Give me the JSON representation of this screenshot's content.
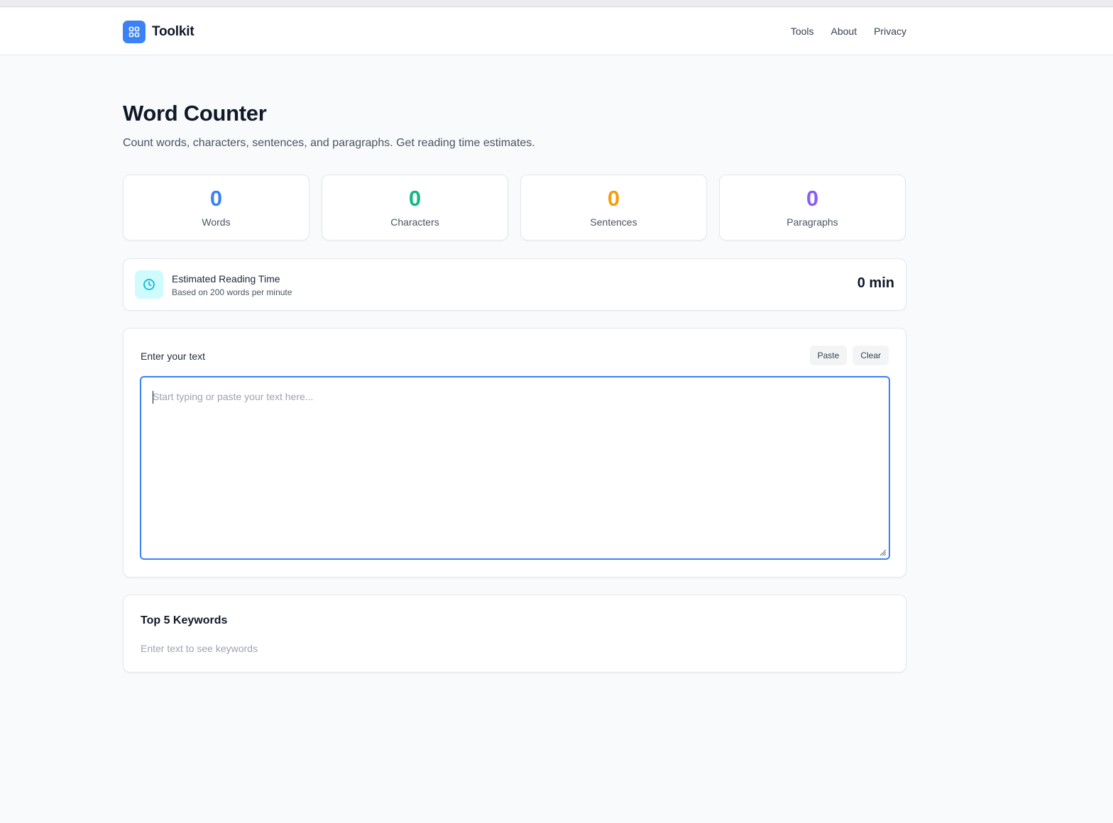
{
  "nav": {
    "brand": "Toolkit",
    "links": [
      "Tools",
      "About",
      "Privacy"
    ]
  },
  "page": {
    "title": "Word Counter",
    "subtitle": "Count words, characters, sentences, and paragraphs. Get reading time estimates."
  },
  "stats": [
    {
      "value": "0",
      "label": "Words",
      "color": "#3b82f6"
    },
    {
      "value": "0",
      "label": "Characters",
      "color": "#10b981"
    },
    {
      "value": "0",
      "label": "Sentences",
      "color": "#f59e0b"
    },
    {
      "value": "0",
      "label": "Paragraphs",
      "color": "#8b5cf6"
    }
  ],
  "reading": {
    "icon": "clock-icon",
    "title": "Estimated Reading Time",
    "subtitle": "Based on 200 words per minute",
    "value": "0 min"
  },
  "editor": {
    "label": "Enter your text",
    "paste_label": "Paste",
    "clear_label": "Clear",
    "placeholder": "Start typing or paste your text here...",
    "value": ""
  },
  "keywords": {
    "title": "Top 5 Keywords",
    "empty_text": "Enter text to see keywords"
  },
  "colors": {
    "accent": "#3b82f6",
    "reading_icon_bg": "#cffafe",
    "reading_icon": "#06b6d4"
  }
}
